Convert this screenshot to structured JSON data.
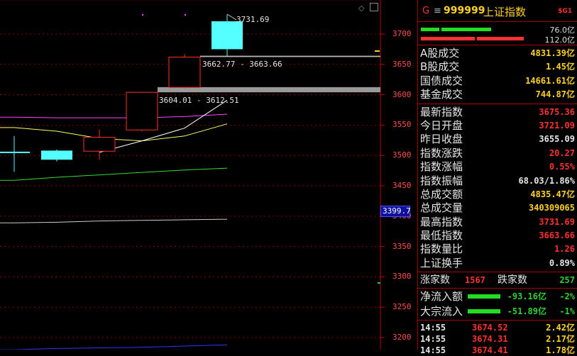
{
  "chart": {
    "y_axis_ticks": [
      "3700",
      "3650",
      "3600",
      "3550",
      "3500",
      "3450",
      "3400",
      "3350",
      "3300",
      "3250",
      "3200"
    ],
    "cursor_price": "3399.7",
    "annotation_high": "3731.69",
    "annotation_range1": "3662.77 - 3663.66",
    "annotation_range2": "3604.01 - 3612.51",
    "up_color": "#ff3030",
    "down_color": "#54ffff",
    "chart_data": {
      "type": "candlestick",
      "ylim": [
        3190,
        3770
      ],
      "candles": [
        {
          "open": 3505,
          "close": 3505,
          "high": 3532,
          "low": 3473,
          "dir": "flat"
        },
        {
          "open": 3508,
          "close": 3493,
          "high": 3510,
          "low": 3490,
          "dir": "down"
        },
        {
          "open": 3507,
          "close": 3530,
          "high": 3543,
          "low": 3493,
          "dir": "up"
        },
        {
          "open": 3542,
          "close": 3604,
          "high": 3605,
          "low": 3540,
          "dir": "up"
        },
        {
          "open": 3612,
          "close": 3662,
          "high": 3667,
          "low": 3610,
          "dir": "up"
        },
        {
          "open": 3721,
          "close": 3675,
          "high": 3732,
          "low": 3664,
          "dir": "down"
        }
      ],
      "moving_averages": [
        {
          "color": "#ffff66",
          "values": [
            3546,
            3540,
            3528,
            3524,
            3532,
            3552
          ]
        },
        {
          "color": "#ff40ff",
          "values": [
            3563,
            3562,
            3562,
            3562,
            3564,
            3568
          ]
        },
        {
          "color": "#ffffff",
          "values": [
            null,
            null,
            null,
            3524,
            3545,
            3591
          ]
        },
        {
          "color": "#33dd33",
          "values": [
            3459,
            3464,
            3468,
            3472,
            3476,
            3479
          ]
        },
        {
          "color": "#cccccc",
          "values": [
            3389,
            3390,
            3392,
            3393,
            3394,
            3395
          ]
        },
        {
          "color": "#3333ff",
          "values": [
            3180,
            3182,
            3183,
            3184,
            3186,
            3188
          ]
        }
      ],
      "gaps": [
        {
          "low": 3662.77,
          "high": 3663.66
        },
        {
          "low": 3604.01,
          "high": 3612.51
        }
      ]
    }
  },
  "panel": {
    "letter": "G",
    "menu_icon": "≡",
    "code": "999999",
    "name": "上证指数",
    "badge": "$G1",
    "bar1_value": "76.0亿",
    "bar2_value": "112.0亿",
    "turnover": [
      {
        "label": "A股成交",
        "value": "4831.39亿",
        "color": "yellow"
      },
      {
        "label": "B股成交",
        "value": "1.45亿",
        "color": "yellow"
      },
      {
        "label": "国债成交",
        "value": "14661.61亿",
        "color": "yellow"
      },
      {
        "label": "基金成交",
        "value": "744.87亿",
        "color": "yellow"
      }
    ],
    "stats": [
      {
        "label": "最新指数",
        "value": "3675.36",
        "color": "red"
      },
      {
        "label": "今日开盘",
        "value": "3721.09",
        "color": "red"
      },
      {
        "label": "昨日收盘",
        "value": "3655.09",
        "color": "white"
      },
      {
        "label": "指数涨跌",
        "value": "20.27",
        "color": "red"
      },
      {
        "label": "指数涨幅",
        "value": "0.55%",
        "color": "red"
      },
      {
        "label": "指数振幅",
        "value": "68.03/1.86%",
        "color": "white"
      },
      {
        "label": "总成交额",
        "value": "4835.47亿",
        "color": "yellow"
      },
      {
        "label": "总成交量",
        "value": "340309065",
        "color": "yellow"
      },
      {
        "label": "最高指数",
        "value": "3731.69",
        "color": "red"
      },
      {
        "label": "最低指数",
        "value": "3663.66",
        "color": "red"
      },
      {
        "label": "指数量比",
        "value": "1.26",
        "color": "red"
      },
      {
        "label": "上证换手",
        "value": "0.89%",
        "color": "white"
      }
    ],
    "up_label": "涨家数",
    "up_count": "1567",
    "down_label": "跌家数",
    "down_count": "257",
    "flows": [
      {
        "label": "净流入额",
        "value": "-93.16亿",
        "pct": "-2%"
      },
      {
        "label": "大宗流入",
        "value": "-51.89亿",
        "pct": "-1%"
      }
    ],
    "ticks": [
      {
        "time": "14:55",
        "price": "3674.52",
        "amount": "2.42亿"
      },
      {
        "time": "14:55",
        "price": "3674.31",
        "amount": "2.17亿"
      },
      {
        "time": "14:55",
        "price": "3674.41",
        "amount": "1.78亿"
      }
    ]
  }
}
